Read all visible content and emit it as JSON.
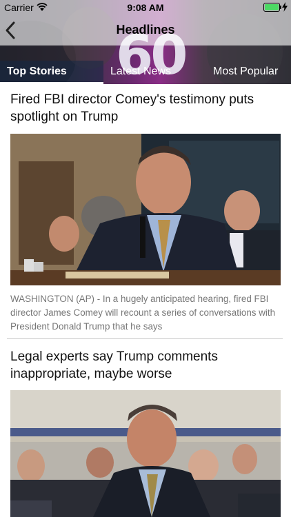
{
  "status_bar": {
    "carrier": "Carrier",
    "time": "9:08 AM",
    "battery_color": "#4cd964"
  },
  "nav": {
    "title": "Headlines",
    "back_icon": "chevron-left-icon",
    "background_text": "60"
  },
  "tabs": [
    {
      "label": "Top Stories",
      "active": true
    },
    {
      "label": "Latest News",
      "active": false
    },
    {
      "label": "Most Popular",
      "active": false
    }
  ],
  "articles": [
    {
      "headline": "Fired FBI director Comey's testimony puts spotlight on Trump",
      "image": "comey-testimony-photo",
      "summary": "WASHINGTON (AP) - In a hugely anticipated hearing, fired FBI director James Comey will recount a series of conversations with President Donald Trump that he says"
    },
    {
      "headline": "Legal experts say Trump comments inappropriate, maybe worse",
      "image": "comey-hearing-photo"
    }
  ]
}
